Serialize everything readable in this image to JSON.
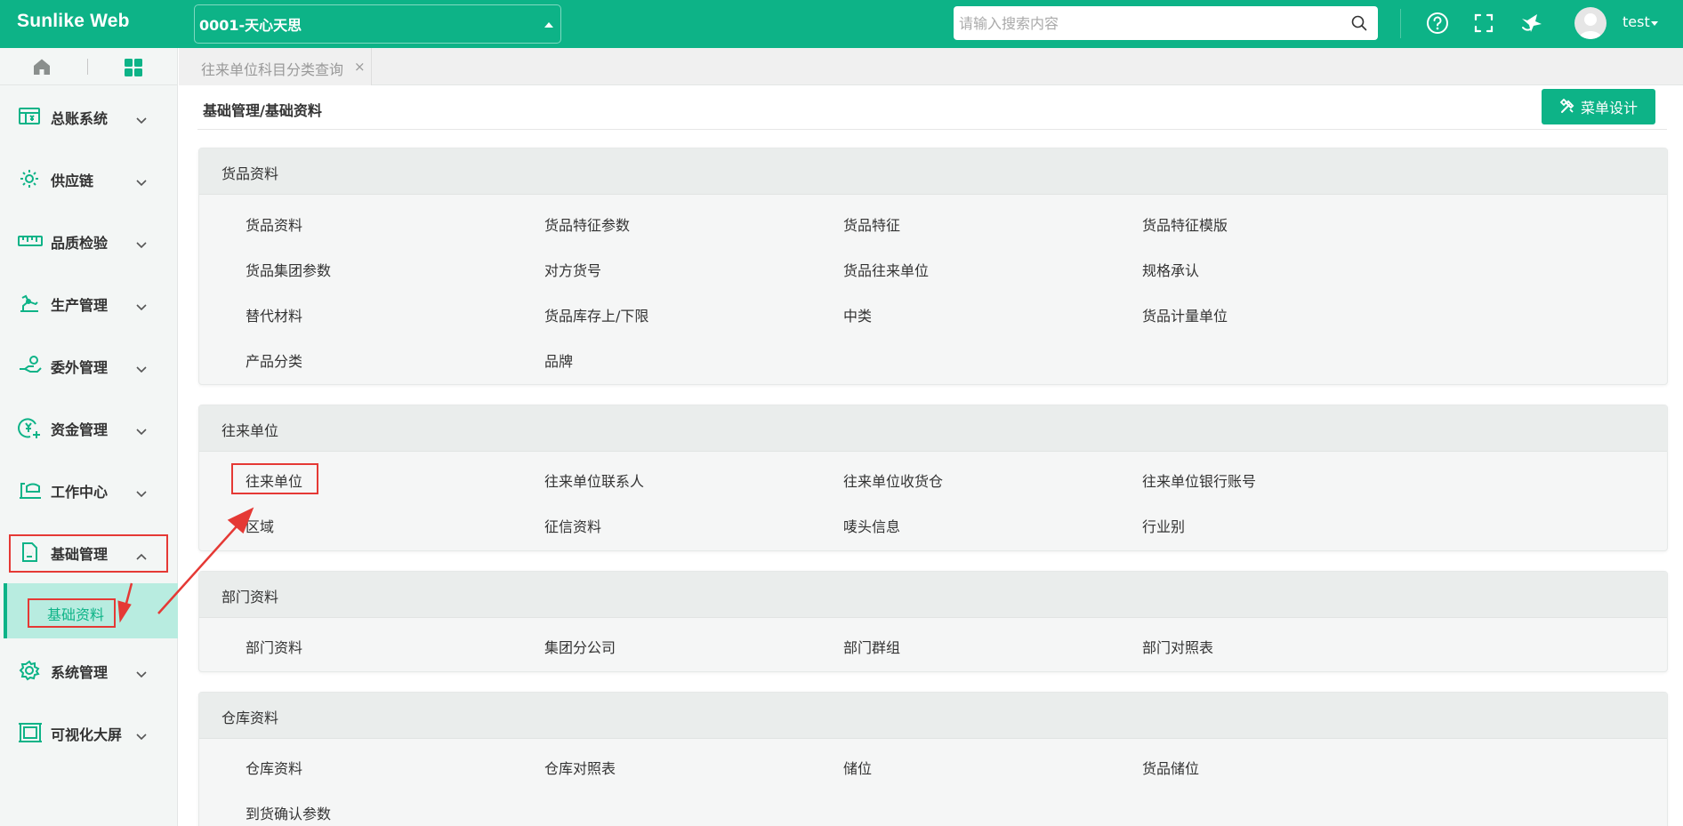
{
  "header": {
    "logo": "Sunlike Web",
    "company": "0001-天心天思",
    "search_placeholder": "请输入搜索内容",
    "user": "test",
    "colors": {
      "primary": "#0db387",
      "highlight": "#e53935"
    },
    "icons": [
      "help-icon",
      "fullscreen-icon",
      "theme-icon"
    ]
  },
  "sidebar": {
    "items": [
      {
        "label": "总账系统",
        "icon": "ledger-icon"
      },
      {
        "label": "供应链",
        "icon": "supply-chain-icon"
      },
      {
        "label": "品质检验",
        "icon": "ruler-icon"
      },
      {
        "label": "生产管理",
        "icon": "production-icon"
      },
      {
        "label": "委外管理",
        "icon": "outsource-icon"
      },
      {
        "label": "资金管理",
        "icon": "funds-icon"
      },
      {
        "label": "工作中心",
        "icon": "workcenter-icon"
      },
      {
        "label": "基础管理",
        "icon": "document-icon"
      },
      {
        "label": "系统管理",
        "icon": "settings-icon"
      },
      {
        "label": "可视化大屏",
        "icon": "screen-icon"
      }
    ],
    "submenu_active": "基础资料"
  },
  "tabs": [
    {
      "label": "往来单位科目分类查询"
    }
  ],
  "main": {
    "breadcrumb": "基础管理/基础资料",
    "design_button": "菜单设计",
    "sections": [
      {
        "title": "货品资料",
        "items": [
          "货品资料",
          "货品特征参数",
          "货品特征",
          "货品特征模版",
          "货品集团参数",
          "对方货号",
          "货品往来单位",
          "规格承认",
          "替代材料",
          "货品库存上/下限",
          "中类",
          "货品计量单位",
          "产品分类",
          "品牌"
        ]
      },
      {
        "title": "往来单位",
        "items": [
          "往来单位",
          "往来单位联系人",
          "往来单位收货仓",
          "往来单位银行账号",
          "区域",
          "征信资料",
          "唛头信息",
          "行业别"
        ]
      },
      {
        "title": "部门资料",
        "items": [
          "部门资料",
          "集团分公司",
          "部门群组",
          "部门对照表"
        ]
      },
      {
        "title": "仓库资料",
        "items": [
          "仓库资料",
          "仓库对照表",
          "储位",
          "货品储位",
          "到货确认参数"
        ]
      }
    ]
  }
}
